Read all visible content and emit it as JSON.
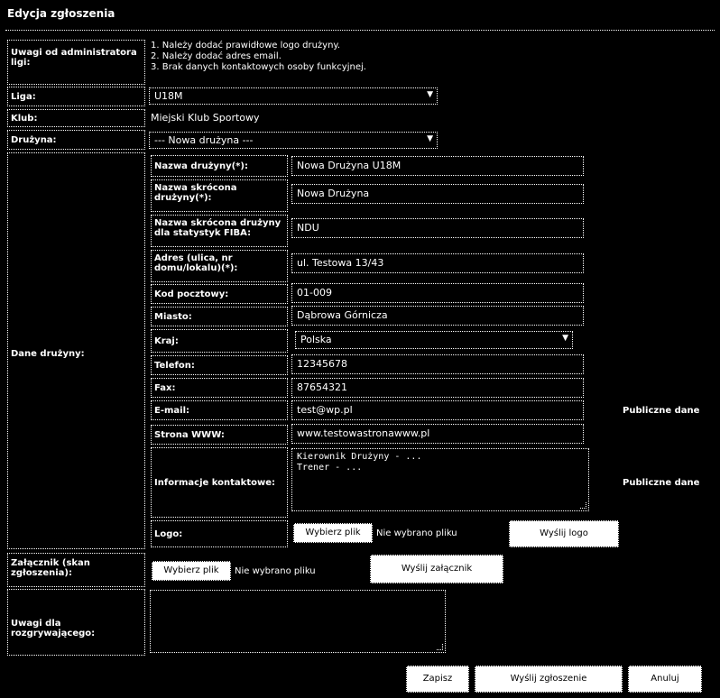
{
  "title": "Edycja zgłoszenia",
  "admin": {
    "label": "Uwagi od administratora ligi:",
    "notes": [
      "1. Należy dodać prawidłowe logo drużyny.",
      "2. Należy dodać adres email.",
      "3. Brak danych kontaktowych osoby funkcyjnej."
    ]
  },
  "rows": {
    "liga_label": "Liga:",
    "liga_value": "U18M",
    "klub_label": "Klub:",
    "klub_value": "Miejski Klub Sportowy",
    "druzyna_label": "Drużyna:",
    "druzyna_value": "--- Nowa drużyna ---",
    "dane_label": "Dane drużyny:"
  },
  "team": {
    "fields": [
      {
        "label": "Nazwa drużyny(*):",
        "value": "Nowa Drużyna U18M"
      },
      {
        "label": "Nazwa skrócona drużyny(*):",
        "value": "Nowa Drużyna"
      },
      {
        "label": "Nazwa skrócona drużyny dla statystyk FIBA:",
        "value": "NDU"
      },
      {
        "label": "Adres (ulica, nr domu/lokalu)(*):",
        "value": "ul. Testowa 13/43"
      },
      {
        "label": "Kod pocztowy:",
        "value": "01-009"
      },
      {
        "label": "Miasto:",
        "value": "Dąbrowa Górnicza"
      }
    ],
    "kraj_label": "Kraj:",
    "kraj_value": "Polska",
    "fields2": [
      {
        "label": "Telefon:",
        "value": "12345678"
      },
      {
        "label": "Fax:",
        "value": "87654321"
      },
      {
        "label": "E-mail:",
        "value": "test@wp.pl"
      },
      {
        "label": "Strona WWW:",
        "value": "www.testowastronawww.pl"
      }
    ],
    "public_label_email": "Publiczne dane",
    "info_label": "Informacje kontaktowe:",
    "info_value_line1": "Kierownik Drużyny - ...",
    "info_value_line2": "Trener - ...",
    "public_label_info": "Publiczne dane",
    "logo_label": "Logo:",
    "logo_choose": "Wybierz plik",
    "logo_nofile": "Nie wybrano pliku",
    "logo_button": "Wyślij logo"
  },
  "attachment": {
    "label": "Załącznik (skan zgłoszenia):",
    "choose": "Wybierz plik",
    "nofile": "Nie wybrano pliku",
    "button": "Wyślij załącznik"
  },
  "comments": {
    "label": "Uwagi dla rozgrywającego:"
  },
  "actions": {
    "b1": "Zapisz",
    "b2": "Wyślij zgłoszenie",
    "b3": "Anuluj"
  }
}
